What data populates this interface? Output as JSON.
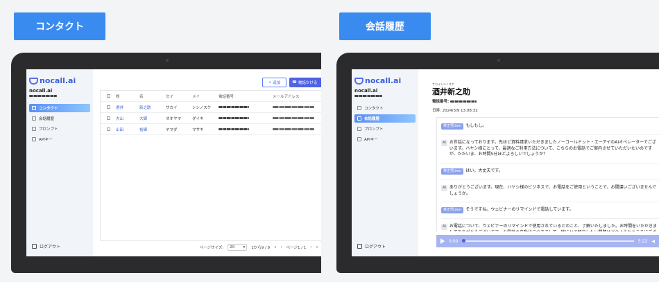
{
  "badges": {
    "left": "コンタクト",
    "right": "会話履歴"
  },
  "app": {
    "logo_text": "nocall.ai",
    "org_name": "nocall.ai"
  },
  "sidebar": {
    "items": [
      {
        "label": "コンタクト",
        "icon": "user-icon"
      },
      {
        "label": "会話履歴",
        "icon": "chat-icon"
      },
      {
        "label": "プロンプト",
        "icon": "edit-icon"
      },
      {
        "label": "APIキー",
        "icon": "key-icon"
      }
    ],
    "logout": "ログアウト"
  },
  "contacts": {
    "add_button": "追加",
    "call_button": "電話かける",
    "columns": [
      "姓",
      "名",
      "セイ",
      "メイ",
      "電話番号",
      "メールアドレス"
    ],
    "rows": [
      {
        "sei": "酒井",
        "mei": "新之助",
        "sei_kana": "サカイ",
        "mei_kana": "シンノスケ"
      },
      {
        "sei": "大山",
        "mei": "大輝",
        "sei_kana": "オオヤマ",
        "mei_kana": "ダイキ"
      },
      {
        "sei": "山田",
        "mei": "裕輝",
        "sei_kana": "ヤマダ",
        "mei_kana": "マサキ"
      }
    ],
    "pager": {
      "page_size_label": "ページサイズ:",
      "page_size": "20",
      "range": "1から9 / 9",
      "page": "ページ1 / 1"
    }
  },
  "detail": {
    "kana": "サカイシンノスケ",
    "name": "酒井新之助",
    "tel_label": "電話番号:",
    "date": "日時: 2024/3/9 13:08:32",
    "messages": [
      {
        "role": "林正悟User",
        "text": "もしもし。"
      },
      {
        "role": "AI",
        "text": "お世話になっております。先ほど資料請求いただきましたノーコールドット・エーアイのAIオペレーターでございます。ハヤシ様にとって、最適なご利用方法について、こちらのお電話でご案内させていただいたいのですが、ただいま、お時間5分ほどよろしいでしょうか？"
      },
      {
        "role": "林正悟User",
        "text": "はい。大丈夫です。"
      },
      {
        "role": "AI",
        "text": "ありがとうございます。現在、ハヤシ様のビジネスで、お電話をご使用ということで、お間違いございませんでしょうか。"
      },
      {
        "role": "林正悟User",
        "text": "そうですね。ウェビナーのリマインドで電話しています。"
      },
      {
        "role": "AI",
        "text": "お電話について、ウェビナーのリマインドで使用されているとのこと、了解いたしました。お時間をいただきましてありがとうございます。お電話の自動化につきまして、特にAIで解決したい問題はどのようなところにございますでしょうか。"
      }
    ],
    "player": {
      "current": "0:00",
      "total": "5:22"
    }
  }
}
